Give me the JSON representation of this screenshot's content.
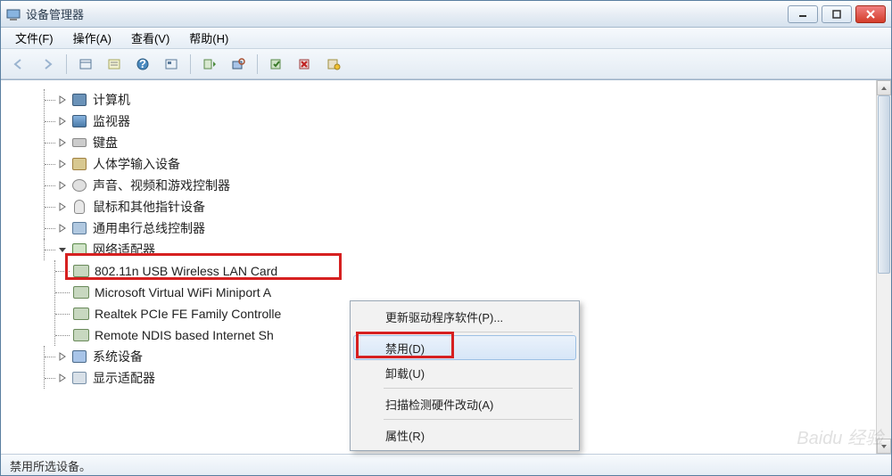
{
  "titlebar": {
    "title": "设备管理器"
  },
  "menu": {
    "file": "文件(F)",
    "action": "操作(A)",
    "view": "查看(V)",
    "help": "帮助(H)"
  },
  "tree": {
    "items": [
      {
        "label": "计算机",
        "icon": "computer"
      },
      {
        "label": "监视器",
        "icon": "monitor"
      },
      {
        "label": "键盘",
        "icon": "keyboard"
      },
      {
        "label": "人体学输入设备",
        "icon": "hid"
      },
      {
        "label": "声音、视频和游戏控制器",
        "icon": "audio"
      },
      {
        "label": "鼠标和其他指针设备",
        "icon": "mouse"
      },
      {
        "label": "通用串行总线控制器",
        "icon": "usb"
      }
    ],
    "netadapter": {
      "label": "网络适配器",
      "children": [
        {
          "label": "802.11n USB Wireless LAN Card"
        },
        {
          "label": "Microsoft Virtual WiFi Miniport A"
        },
        {
          "label": "Realtek PCIe FE Family Controlle"
        },
        {
          "label": "Remote NDIS based Internet Sh"
        }
      ]
    },
    "tail": [
      {
        "label": "系统设备",
        "icon": "sys"
      },
      {
        "label": "显示适配器",
        "icon": "display"
      }
    ]
  },
  "context_menu": {
    "update": "更新驱动程序软件(P)...",
    "disable": "禁用(D)",
    "uninstall": "卸载(U)",
    "scan": "扫描检测硬件改动(A)",
    "properties": "属性(R)"
  },
  "statusbar": {
    "text": "禁用所选设备。"
  },
  "watermark": "Baidu 经验"
}
